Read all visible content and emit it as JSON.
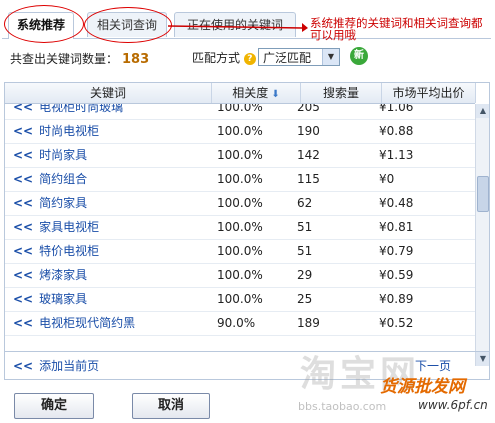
{
  "tabs": [
    {
      "label": "系统推荐",
      "active": true
    },
    {
      "label": "相关词查询",
      "active": false
    },
    {
      "label": "正在使用的关键词",
      "active": false
    }
  ],
  "annotation": "系统推荐的关键词和相关词查询都可以用哦",
  "summary": {
    "count_label": "共查出关键词数量：",
    "count": "183"
  },
  "match": {
    "label": "匹配方式",
    "selected": "广泛匹配",
    "new_badge": "新"
  },
  "table": {
    "headers": [
      "关键词",
      "相关度",
      "搜索量",
      "市场平均出价"
    ],
    "rows": [
      {
        "keyword": "电视柜时尚玻璃",
        "relevance": "100.0%",
        "volume": "205",
        "price": "¥1.06"
      },
      {
        "keyword": "时尚电视柜",
        "relevance": "100.0%",
        "volume": "190",
        "price": "¥0.88"
      },
      {
        "keyword": "时尚家具",
        "relevance": "100.0%",
        "volume": "142",
        "price": "¥1.13"
      },
      {
        "keyword": "简约组合",
        "relevance": "100.0%",
        "volume": "115",
        "price": "¥0"
      },
      {
        "keyword": "简约家具",
        "relevance": "100.0%",
        "volume": "62",
        "price": "¥0.48"
      },
      {
        "keyword": "家具电视柜",
        "relevance": "100.0%",
        "volume": "51",
        "price": "¥0.81"
      },
      {
        "keyword": "特价电视柜",
        "relevance": "100.0%",
        "volume": "51",
        "price": "¥0.79"
      },
      {
        "keyword": "烤漆家具",
        "relevance": "100.0%",
        "volume": "29",
        "price": "¥0.59"
      },
      {
        "keyword": "玻璃家具",
        "relevance": "100.0%",
        "volume": "25",
        "price": "¥0.89"
      },
      {
        "keyword": "电视柜现代简约黑",
        "relevance": "90.0%",
        "volume": "189",
        "price": "¥0.52"
      }
    ]
  },
  "footer": {
    "add_page": "添加当前页",
    "pager": "下一页"
  },
  "buttons": {
    "ok": "确定",
    "cancel": "取消"
  },
  "watermark": {
    "text": "淘宝网",
    "url": "bbs.taobao.com"
  },
  "brand": {
    "name": "货源批发网",
    "url": "www.6pf.cn"
  },
  "colors": {
    "accent": "#1a4ea8",
    "annotation": "#cc0000",
    "count": "#b86b00"
  }
}
